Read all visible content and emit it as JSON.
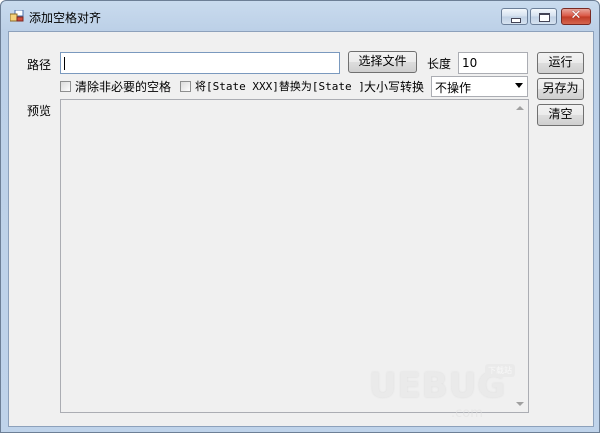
{
  "window": {
    "title": "添加空格对齐",
    "close_glyph": "✕"
  },
  "form": {
    "path_label": "路径",
    "path_value": "",
    "choose_file_button": "选择文件",
    "length_label": "长度",
    "length_value": "10",
    "run_button": "运行",
    "save_as_button": "另存为",
    "clear_button": "清空",
    "remove_spaces_checkbox": "清除非必要的空格",
    "replace_state_checkbox": "将[State XXX]替换为[State ]",
    "case_convert_label": "大小写转换",
    "case_convert_value": "不操作",
    "preview_label": "预览"
  },
  "watermark": {
    "main": "UEBUG",
    "badge": "下载站",
    "sub": ".com"
  },
  "colors": {
    "title_bar": "#bcd0e7",
    "client_bg": "#f0f0f0",
    "close_button": "#c03a25"
  }
}
